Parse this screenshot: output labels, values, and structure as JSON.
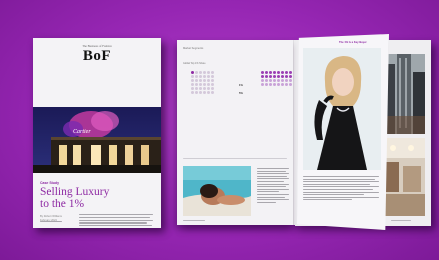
{
  "cover": {
    "publisher_small": "The Business of Fashion",
    "logo": "BoF",
    "sign": "Cartier",
    "tag": "Case Study",
    "title_line1": "Selling Luxury",
    "title_line2": "to the 1%",
    "byline_line1": "By Robert Williams",
    "byline_line2": "February 2024"
  },
  "spread": {
    "page_header": "Market Segments",
    "chart_heading": "Global Top 1% Share",
    "stat1": "1%",
    "stat2": "5%",
    "pull_label": "The 1% Is a Key Buyer"
  },
  "colors": {
    "background": "#9a2bb6",
    "accent": "#8e2aa3",
    "dot_dark": "#4a2c58",
    "dot_light": "#c9a3d8"
  }
}
